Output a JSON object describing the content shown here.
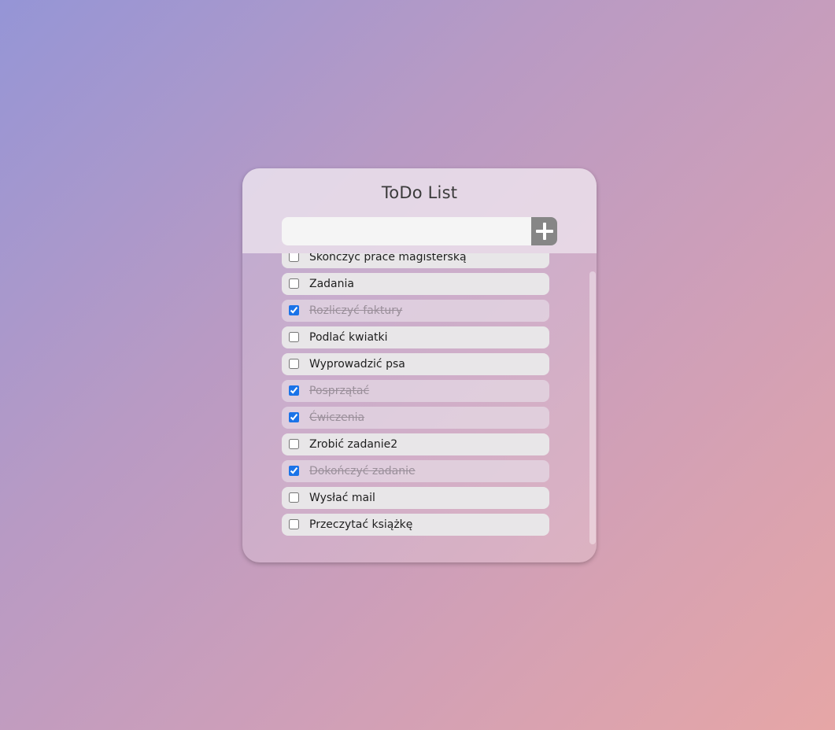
{
  "app": {
    "title": "ToDo List"
  },
  "input": {
    "value": "",
    "placeholder": ""
  },
  "add_button": {
    "icon": "plus-icon"
  },
  "tasks": [
    {
      "label": "Skończyć prace magisterską",
      "done": false
    },
    {
      "label": "Zadania",
      "done": false
    },
    {
      "label": "Rozliczyć faktury",
      "done": true
    },
    {
      "label": "Podlać kwiatki",
      "done": false
    },
    {
      "label": "Wyprowadzić psa",
      "done": false
    },
    {
      "label": "Posprzątać",
      "done": true
    },
    {
      "label": "Ćwiczenia",
      "done": true
    },
    {
      "label": "Zrobić zadanie2",
      "done": false
    },
    {
      "label": "Dokończyć zadanie",
      "done": true
    },
    {
      "label": "Wysłać mail",
      "done": false
    },
    {
      "label": "Przeczytać książkę",
      "done": false
    }
  ],
  "colors": {
    "checkbox_accent": "#1a73e8",
    "add_button_bg": "#868686"
  }
}
